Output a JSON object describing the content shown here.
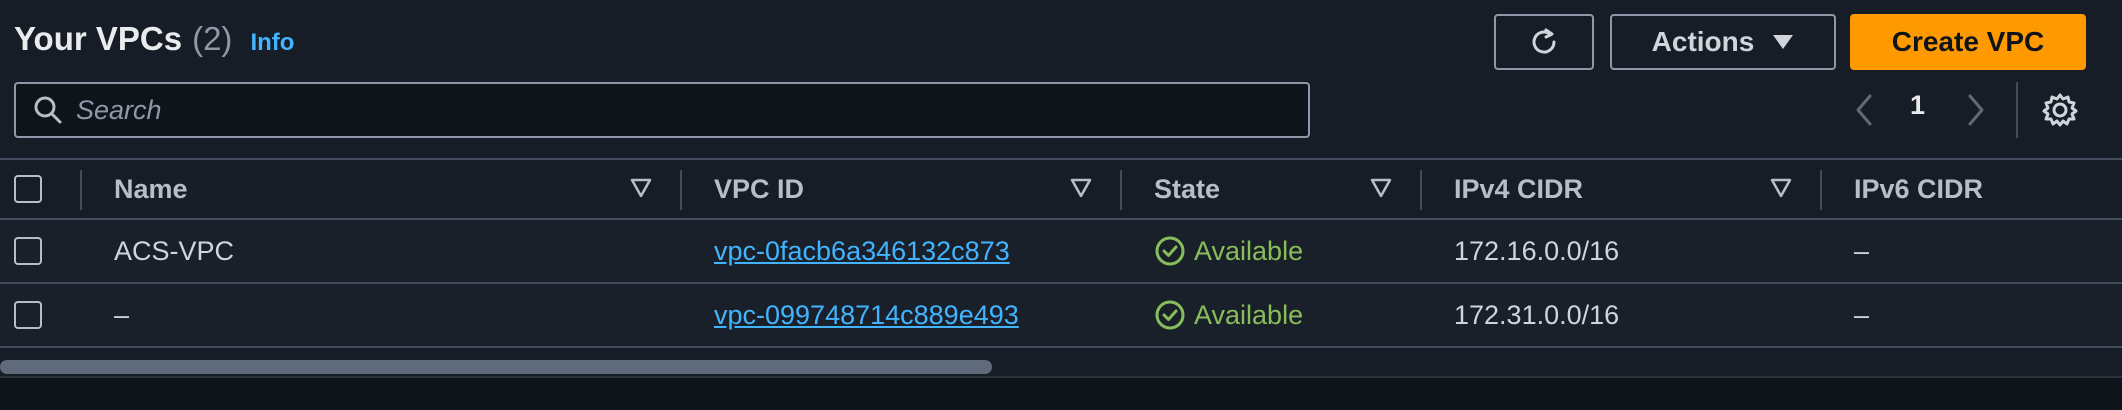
{
  "header": {
    "title": "Your VPCs",
    "count": "(2)",
    "info_label": "Info"
  },
  "toolbar": {
    "refresh_icon": "refresh-icon",
    "actions_label": "Actions",
    "create_label": "Create VPC"
  },
  "search": {
    "placeholder": "Search",
    "value": ""
  },
  "pagination": {
    "current_page": "1"
  },
  "table": {
    "columns": [
      "Name",
      "VPC ID",
      "State",
      "IPv4 CIDR",
      "IPv6 CIDR"
    ],
    "rows": [
      {
        "name": "ACS-VPC",
        "vpc_id": "vpc-0facb6a346132c873",
        "state": "Available",
        "ipv4": "172.16.0.0/16",
        "ipv6": "–"
      },
      {
        "name": "–",
        "vpc_id": "vpc-099748714c889e493",
        "state": "Available",
        "ipv4": "172.31.0.0/16",
        "ipv6": "–"
      }
    ]
  },
  "colors": {
    "accent": "#ff9900",
    "link": "#42b4ff",
    "status_available": "#89bd5a",
    "background": "#161d26"
  }
}
